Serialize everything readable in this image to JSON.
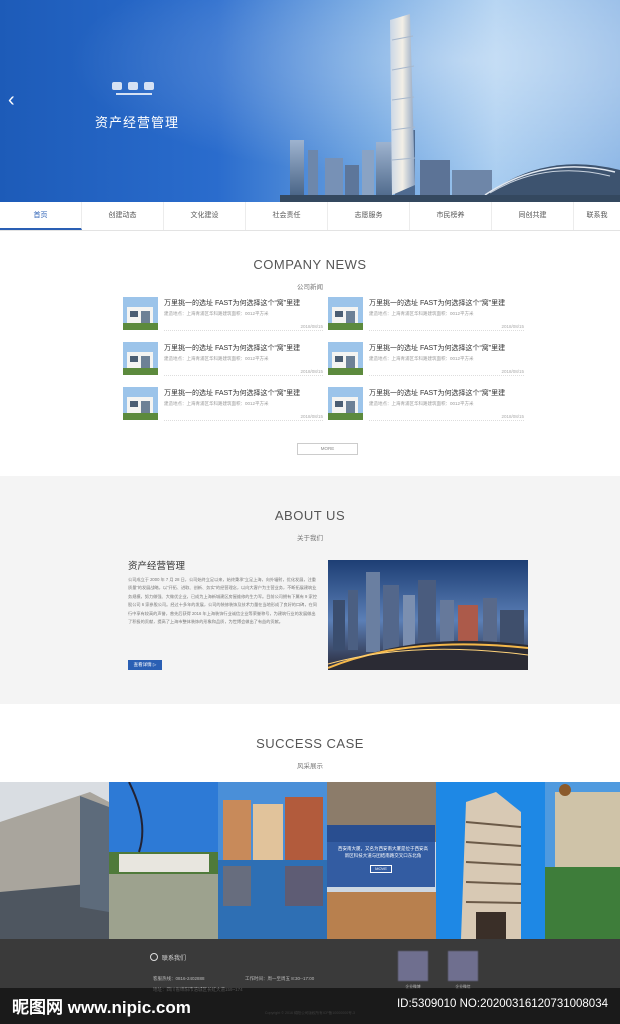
{
  "hero": {
    "title": "资产经营管理",
    "prev_icon": "‹"
  },
  "nav": {
    "items": [
      "首页",
      "创建动态",
      "文化建设",
      "社会责任",
      "志愿服务",
      "市民榜养",
      "同创共建",
      "联系我"
    ]
  },
  "news": {
    "title": "COMPANY NEWS",
    "subtitle": "公司新闻",
    "items": [
      {
        "headline": "万里挑一的选址 FAST为何选择这个“窝”里建",
        "meta": "建造地点：上海青浦区华科路建筑面积：0012平方米",
        "date": "2018/08/15"
      },
      {
        "headline": "万里挑一的选址 FAST为何选择这个“窝”里建",
        "meta": "建造地点：上海青浦区华科路建筑面积：0012平方米",
        "date": "2018/08/15"
      },
      {
        "headline": "万里挑一的选址 FAST为何选择这个“窝”里建",
        "meta": "建造地点：上海青浦区华科路建筑面积：0012平方米",
        "date": "2018/08/15"
      },
      {
        "headline": "万里挑一的选址 FAST为何选择这个“窝”里建",
        "meta": "建造地点：上海青浦区华科路建筑面积：0012平方米",
        "date": "2018/08/15"
      },
      {
        "headline": "万里挑一的选址 FAST为何选择这个“窝”里建",
        "meta": "建造地点：上海青浦区华科路建筑面积：0012平方米",
        "date": "2018/08/15"
      },
      {
        "headline": "万里挑一的选址 FAST为何选择这个“窝”里建",
        "meta": "建造地点：上海青浦区华科路建筑面积：0012平方米",
        "date": "2018/08/15"
      }
    ],
    "more_label": "MORE"
  },
  "about": {
    "title": "ABOUT US",
    "subtitle": "关于我们",
    "name": "资产经营管理",
    "text": "公司成立于 2000 年 7 月 28 日，公司始终立足以来，始终秉承“立足上海，向外辐射，优化发展，注重质量”的发展战略，以“开拓、进取、创新、务实”的经营理念，以向大客户为主营业务，不断拓展建筑业务规模，努力做强、大做优企业，已成为上海新城建区房屋维修的生力军。目前公司拥有下属有 9 家控股公司 6 家参股公司。经过十多年的发展，公司的装修装饰及技术力量在当地形成了良好的口碑，在同行中享有较高的声誉，曾先后获得 2016 年上海装饰行业诚信企业等荣誉称号，为建筑行业的发展做出了积极的贡献，提高了上海市整体装饰的形象和品质，为世博会做出了有益的贡献。",
    "button_label": "查看详情 ▷"
  },
  "cases": {
    "title": "SUCCESS CASE",
    "subtitle": "风采展示",
    "overlay_text": "西安南大厦，又名为西安南大厦是位于西安高新区科技大道与团结南路交叉口东北角",
    "overlay_button": "MOVE"
  },
  "footer": {
    "contact_label": "联系我们",
    "phone": "客服热线：0816-2402888",
    "hours": "工作时间：周一至周五 8:30--17:00",
    "address": "地址：四川省绵阳市涪城区长虹大道159~174",
    "qr1_label": "企业微博",
    "qr2_label": "企业微信",
    "copyright": "Copyright © 2016 绵阳公司版权所有ICP备10000000号-3"
  },
  "watermark": {
    "brand": "昵图网 www.nipic.com",
    "id": "ID:5309010 NO:20200316120731008034"
  }
}
